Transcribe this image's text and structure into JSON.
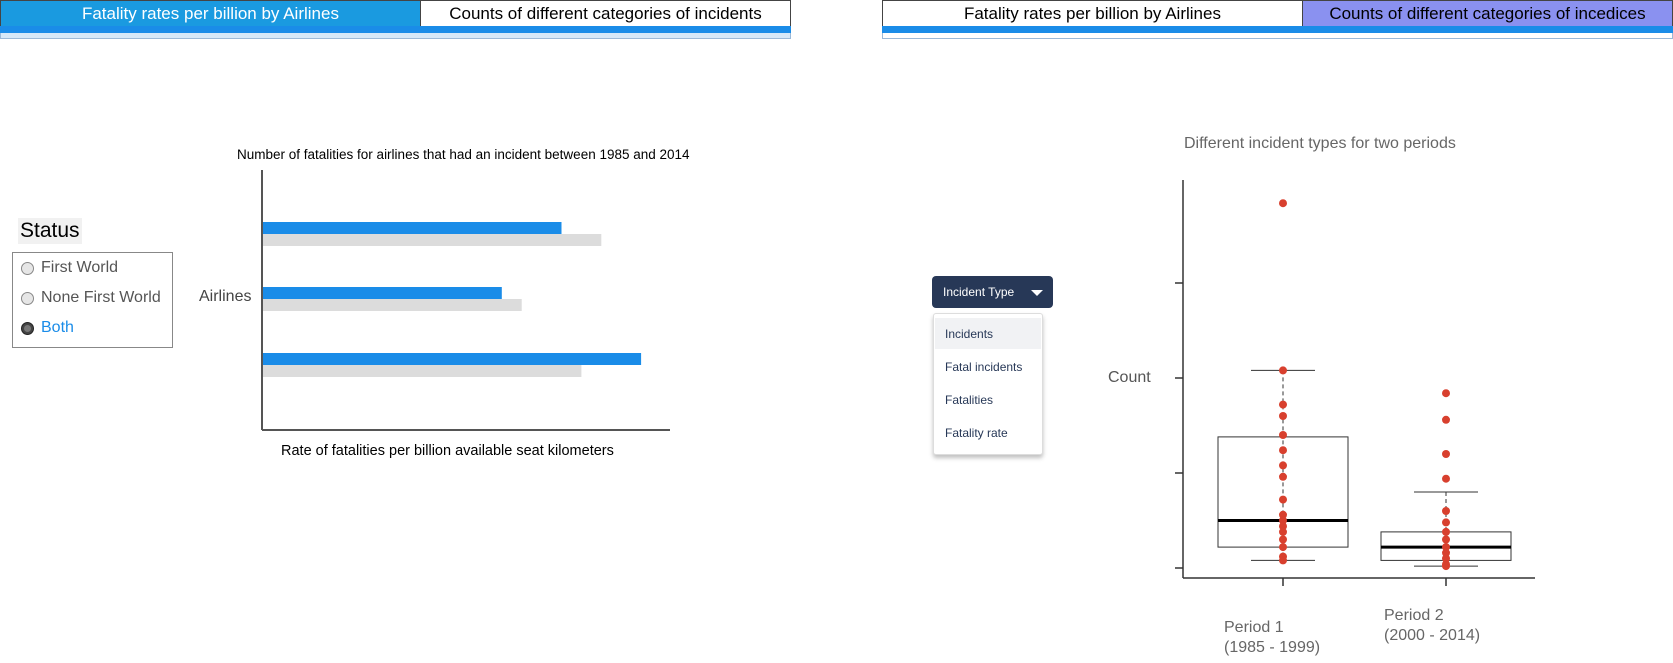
{
  "left_tabs": [
    {
      "label": "Fatality rates per billion by Airlines",
      "active": true
    },
    {
      "label": "Counts of different categories of incidents",
      "active": false
    }
  ],
  "right_tabs": [
    {
      "label": "Fatality rates per billion by Airlines",
      "active": false
    },
    {
      "label": "Counts of different categories of incedices",
      "active": true
    }
  ],
  "status": {
    "title": "Status",
    "options": [
      "First World",
      "None First World",
      "Both"
    ],
    "selected": "Both"
  },
  "bar_chart": {
    "title": "Number of fatalities for airlines that had an incident between 1985 and 2014",
    "ylabel": "Airlines",
    "xlabel": "Rate of fatalities per billion available seat kilometers"
  },
  "dropdown": {
    "label": "Incident Type",
    "options": [
      "Incidents",
      "Fatal incidents",
      "Fatalities",
      "Fatality rate"
    ],
    "highlighted": "Incidents"
  },
  "box_chart": {
    "title": "Different incident types for two periods",
    "ylabel": "Count",
    "periods": [
      {
        "name": "Period 1",
        "range": "(1985 - 1999)"
      },
      {
        "name": "Period 2",
        "range": "(2000 - 2014)"
      }
    ]
  },
  "colors": {
    "accent_blue": "#1a8ce8",
    "tab_blue": "#1a9ae0",
    "tab_purple": "#8a91f0",
    "bar_grey": "#dcdcdc",
    "dot_red": "#d8402e",
    "dropdown_navy": "#273857"
  },
  "chart_data": [
    {
      "type": "bar",
      "orientation": "horizontal",
      "title": "Number of fatalities for airlines that had an incident between 1985 and 2014",
      "ylabel": "Airlines",
      "xlabel": "Rate of fatalities per billion available seat kilometers",
      "tick_labels_shown": false,
      "xlim": [
        0,
        100
      ],
      "categories": [
        "",
        "",
        ""
      ],
      "series": [
        {
          "color": "#1a8ce8",
          "values": [
            75,
            60,
            95
          ]
        },
        {
          "color": "#dcdcdc",
          "values": [
            85,
            65,
            80
          ]
        }
      ],
      "grid": false
    },
    {
      "type": "box",
      "title": "Different incident types for two periods",
      "ylabel": "Count",
      "tick_labels_shown": false,
      "ylim": [
        0,
        10
      ],
      "categories": [
        "Period 1\n(1985 - 1999)",
        "Period 2\n(2000 - 2014)"
      ],
      "boxes": [
        {
          "whisker_low": 0.2,
          "q1": 0.55,
          "median": 1.25,
          "q3": 3.45,
          "whisker_high": 5.2
        },
        {
          "whisker_low": 0.05,
          "q1": 0.2,
          "median": 0.55,
          "q3": 0.95,
          "whisker_high": 2.0
        }
      ],
      "points": [
        {
          "x": "Period 1",
          "values": [
            9.6,
            5.2,
            4.3,
            4.0,
            3.5,
            3.1,
            2.7,
            2.4,
            1.8,
            1.4,
            1.25,
            1.1,
            0.95,
            0.75,
            0.55,
            0.3,
            0.2
          ]
        },
        {
          "x": "Period 2",
          "values": [
            4.6,
            3.9,
            3.0,
            2.35,
            1.5,
            1.2,
            0.95,
            0.75,
            0.55,
            0.4,
            0.25,
            0.1,
            0.05
          ]
        }
      ],
      "grid": false
    }
  ]
}
